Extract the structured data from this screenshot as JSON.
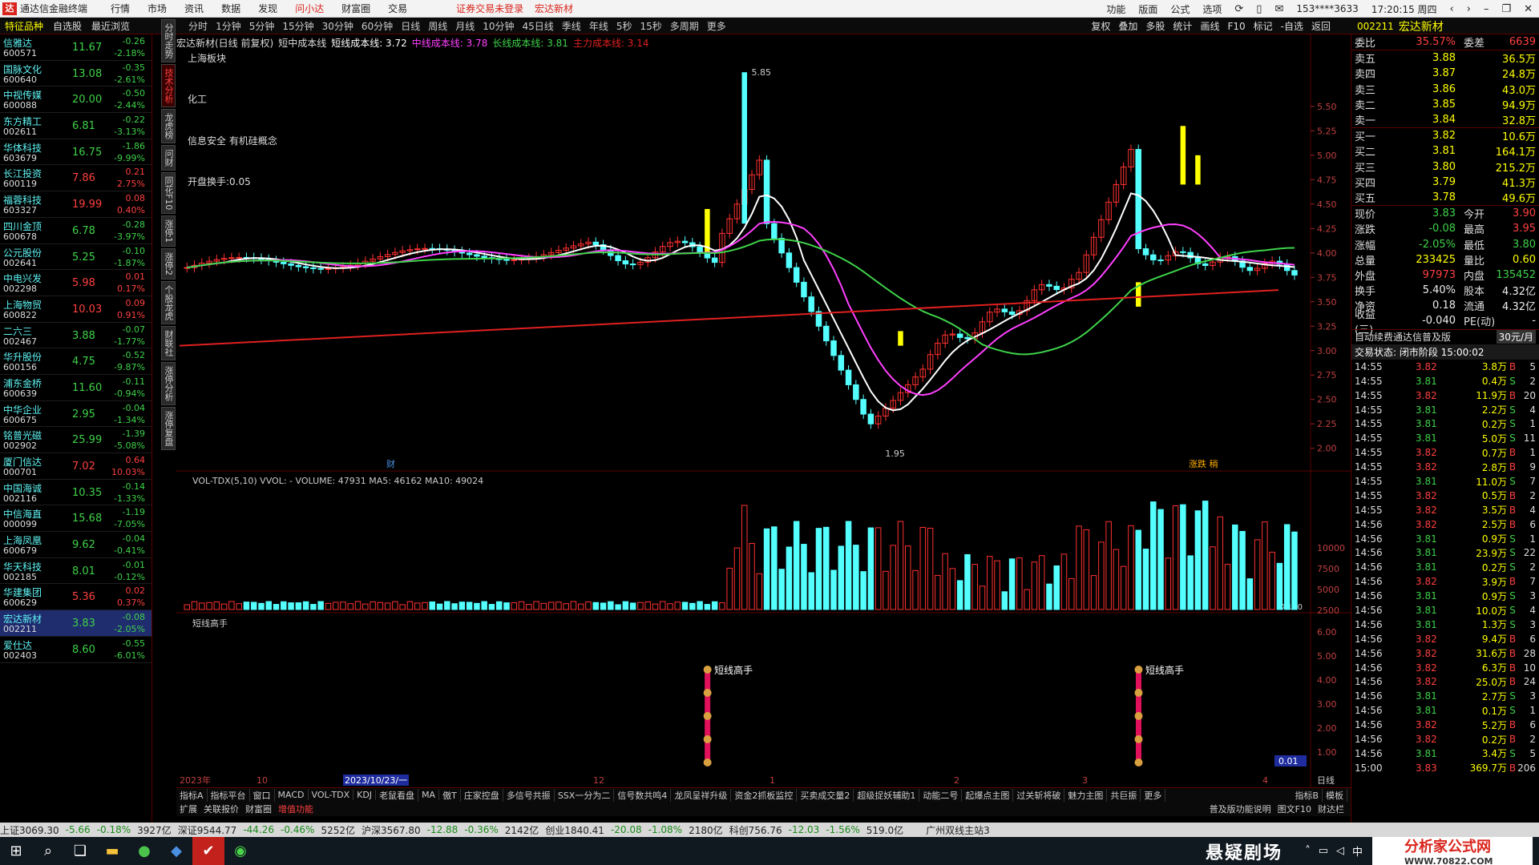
{
  "menubar": {
    "app_title": "通达信金融终端",
    "menus": [
      "行情",
      "市场",
      "资讯",
      "数据",
      "发现",
      "问小达",
      "财富圈",
      "交易"
    ],
    "notice": [
      "证券交易未登录",
      "宏达新材"
    ],
    "right_items": [
      "功能",
      "版面",
      "公式",
      "选项"
    ],
    "account": "153****3633",
    "clock": "17:20:15 周四"
  },
  "toolbar": {
    "tabs": [
      "分时",
      "1分钟",
      "5分钟",
      "15分钟",
      "30分钟",
      "60分钟",
      "日线",
      "周线",
      "月线",
      "10分钟",
      "45日线",
      "季线",
      "年线",
      "5秒",
      "15秒",
      "多周期",
      "更多"
    ],
    "right_tools": [
      "复权",
      "叠加",
      "多股",
      "统计",
      "画线",
      "F10",
      "标记",
      "-自选",
      "返回"
    ],
    "stock_code": "002211",
    "stock_name": "宏达新材"
  },
  "stocklist": {
    "headers": [
      "特征品种",
      "自选股",
      "最近浏览"
    ],
    "rows": [
      {
        "name": "信雅达",
        "code": "600571",
        "price": "11.67",
        "change": "-0.26",
        "pct": "-2.18%",
        "dir": "down"
      },
      {
        "name": "国脉文化",
        "code": "600640",
        "price": "13.08",
        "change": "-0.35",
        "pct": "-2.61%",
        "dir": "down"
      },
      {
        "name": "中视传媒",
        "code": "600088",
        "price": "20.00",
        "change": "-0.50",
        "pct": "-2.44%",
        "dir": "down"
      },
      {
        "name": "东方精工",
        "code": "002611",
        "price": "6.81",
        "change": "-0.22",
        "pct": "-3.13%",
        "dir": "down"
      },
      {
        "name": "华体科技",
        "code": "603679",
        "price": "16.75",
        "change": "-1.86",
        "pct": "-9.99%",
        "dir": "down"
      },
      {
        "name": "长江投资",
        "code": "600119",
        "price": "7.86",
        "change": "0.21",
        "pct": "2.75%",
        "dir": "up"
      },
      {
        "name": "福蓉科技",
        "code": "603327",
        "price": "19.99",
        "change": "0.08",
        "pct": "0.40%",
        "dir": "up"
      },
      {
        "name": "四川金顶",
        "code": "600678",
        "price": "6.78",
        "change": "-0.28",
        "pct": "-3.97%",
        "dir": "down"
      },
      {
        "name": "公元股份",
        "code": "002641",
        "price": "5.25",
        "change": "-0.10",
        "pct": "-1.87%",
        "dir": "down"
      },
      {
        "name": "中电兴发",
        "code": "002298",
        "price": "5.98",
        "change": "0.01",
        "pct": "0.17%",
        "dir": "up"
      },
      {
        "name": "上海物贸",
        "code": "600822",
        "price": "10.03",
        "change": "0.09",
        "pct": "0.91%",
        "dir": "up"
      },
      {
        "name": "二六三",
        "code": "002467",
        "price": "3.88",
        "change": "-0.07",
        "pct": "-1.77%",
        "dir": "down"
      },
      {
        "name": "华升股份",
        "code": "600156",
        "price": "4.75",
        "change": "-0.52",
        "pct": "-9.87%",
        "dir": "down"
      },
      {
        "name": "浦东金桥",
        "code": "600639",
        "price": "11.60",
        "change": "-0.11",
        "pct": "-0.94%",
        "dir": "down"
      },
      {
        "name": "中华企业",
        "code": "600675",
        "price": "2.95",
        "change": "-0.04",
        "pct": "-1.34%",
        "dir": "down"
      },
      {
        "name": "铭普光磁",
        "code": "002902",
        "price": "25.99",
        "change": "-1.39",
        "pct": "-5.08%",
        "dir": "down"
      },
      {
        "name": "厦门信达",
        "code": "000701",
        "price": "7.02",
        "change": "0.64",
        "pct": "10.03%",
        "dir": "up"
      },
      {
        "name": "中国海诚",
        "code": "002116",
        "price": "10.35",
        "change": "-0.14",
        "pct": "-1.33%",
        "dir": "down"
      },
      {
        "name": "中信海直",
        "code": "000099",
        "price": "15.68",
        "change": "-1.19",
        "pct": "-7.05%",
        "dir": "down"
      },
      {
        "name": "上海凤凰",
        "code": "600679",
        "price": "9.62",
        "change": "-0.04",
        "pct": "-0.41%",
        "dir": "down"
      },
      {
        "name": "华天科技",
        "code": "002185",
        "price": "8.01",
        "change": "-0.01",
        "pct": "-0.12%",
        "dir": "down"
      },
      {
        "name": "华建集团",
        "code": "600629",
        "price": "5.36",
        "change": "0.02",
        "pct": "0.37%",
        "dir": "up"
      },
      {
        "name": "宏达新材",
        "code": "002211",
        "price": "3.83",
        "change": "-0.08",
        "pct": "-2.05%",
        "dir": "down",
        "selected": true
      },
      {
        "name": "爱仕达",
        "code": "002403",
        "price": "8.60",
        "change": "-0.55",
        "pct": "-6.01%",
        "dir": "down"
      }
    ]
  },
  "sidetabs": [
    "分时走势",
    "技术分析",
    "龙虎榜",
    "问财",
    "同花F10",
    "涨停1",
    "涨停2",
    "个股龙虎",
    "财联社",
    "涨停分析",
    "涨停复盘"
  ],
  "chart_header": {
    "title": "宏达新材(日线 前复权)",
    "indicator": "短中成本线",
    "short_line": "短线成本线: 3.72",
    "mid_line": "中线成本线: 3.78",
    "long_line": "长线成本线: 3.81",
    "main_line": "主力成本线: 3.14"
  },
  "chart_notes": {
    "sector": "上海板块",
    "industry": "化工",
    "concepts": "信息安全 有机硅概念",
    "turnover": "开盘换手:0.05",
    "high_label": "5.85",
    "low_label": "1.95",
    "marker_cai": "财",
    "marker_right": "涨跌 稍"
  },
  "volume_header": "VOL-TDX(5,10) VVOL: - VOLUME: 47931  MA5: 46162  MA10: 49024",
  "signal_header": "短线高手",
  "signal_label": "短线高手",
  "axis": {
    "price_ticks": [
      "5.50",
      "5.25",
      "5.00",
      "4.75",
      "4.50",
      "4.25",
      "4.00",
      "3.75",
      "3.50",
      "3.25",
      "3.00",
      "2.75",
      "2.50",
      "2.25",
      "2.00"
    ],
    "vol_ticks": [
      "10000",
      "7500",
      "5000",
      "2500"
    ],
    "vol_unit": "X100",
    "signal_ticks": [
      "6.00",
      "5.00",
      "4.00",
      "3.00",
      "2.00",
      "1.00"
    ],
    "signal_current": "0.01",
    "period_label": "日线",
    "dates": [
      "2023年",
      "10",
      "2023/10/23/一",
      "12",
      "1",
      "2",
      "3",
      "4"
    ]
  },
  "chart_data": {
    "type": "line",
    "title": "宏达新材(日线 前复权)",
    "y_range": [
      1.95,
      5.85
    ],
    "series": [
      {
        "name": "短线成本线",
        "value": 3.72
      },
      {
        "name": "中线成本线",
        "value": 3.78
      },
      {
        "name": "长线成本线",
        "value": 3.81
      },
      {
        "name": "主力成本线",
        "value": 3.14
      }
    ]
  },
  "indicator_tabs": [
    "指标A",
    "指标平台",
    "窗口",
    "MACD",
    "VOL-TDX",
    "KDJ",
    "老鼠看盘",
    "MA",
    "傲T",
    "庄家控盘",
    "多信号共振",
    "SSX一分为二",
    "信号数共鸣4",
    "龙凤呈祥升级",
    "资金2抓板监控",
    "买卖成交量2",
    "超级捉妖辅助1",
    "动能二号",
    "起爆点主图",
    "过关斩将破",
    "魅力主图",
    "共巨振",
    "更多"
  ],
  "indicator_tabs_right": [
    "指标B",
    "模板"
  ],
  "sub_tabs": [
    "扩展",
    "关联报价",
    "财富圈",
    "增值功能"
  ],
  "sub_tabs_right": [
    "普及版功能说明",
    "图文F10",
    "财达栏"
  ],
  "rightpanel": {
    "webi": {
      "label": "委比",
      "value": "35.57%",
      "label2": "委差",
      "value2": "6639"
    },
    "asks": [
      {
        "label": "卖五",
        "price": "3.88",
        "vol": "36.5万"
      },
      {
        "label": "卖四",
        "price": "3.87",
        "vol": "24.8万"
      },
      {
        "label": "卖三",
        "price": "3.86",
        "vol": "43.0万"
      },
      {
        "label": "卖二",
        "price": "3.85",
        "vol": "94.9万"
      },
      {
        "label": "卖一",
        "price": "3.84",
        "vol": "32.8万"
      }
    ],
    "bids": [
      {
        "label": "买一",
        "price": "3.82",
        "vol": "10.6万"
      },
      {
        "label": "买二",
        "price": "3.81",
        "vol": "164.1万"
      },
      {
        "label": "买三",
        "price": "3.80",
        "vol": "215.2万"
      },
      {
        "label": "买四",
        "price": "3.79",
        "vol": "41.3万"
      },
      {
        "label": "买五",
        "price": "3.78",
        "vol": "49.6万"
      }
    ],
    "stats": [
      {
        "l1": "现价",
        "v1": "3.83",
        "l2": "今开",
        "v2": "3.90",
        "c1": "down",
        "c2": "up"
      },
      {
        "l1": "涨跌",
        "v1": "-0.08",
        "l2": "最高",
        "v2": "3.95",
        "c1": "down",
        "c2": "up"
      },
      {
        "l1": "涨幅",
        "v1": "-2.05%",
        "l2": "最低",
        "v2": "3.80",
        "c1": "down",
        "c2": "down"
      },
      {
        "l1": "总量",
        "v1": "233425",
        "l2": "量比",
        "v2": "0.60",
        "c1": "yellow",
        "c2": "yellow"
      },
      {
        "l1": "外盘",
        "v1": "97973",
        "l2": "内盘",
        "v2": "135452",
        "c1": "up",
        "c2": "down"
      },
      {
        "l1": "换手",
        "v1": "5.40%",
        "l2": "股本",
        "v2": "4.32亿",
        "c1": "white",
        "c2": "white"
      },
      {
        "l1": "净资",
        "v1": "0.18",
        "l2": "流通",
        "v2": "4.32亿",
        "c1": "white",
        "c2": "white"
      },
      {
        "l1": "收益(三)",
        "v1": "-0.040",
        "l2": "PE(动)",
        "v2": "-",
        "c1": "white",
        "c2": "white"
      }
    ],
    "promo": "自动续费通达信普及版",
    "promo_price": "30元/月",
    "trade_status": "交易状态: 闭市阶段 15:00:02",
    "ticks": [
      {
        "t": "14:55",
        "p": "3.82",
        "v": "3.8万",
        "bs": "B",
        "n": "5"
      },
      {
        "t": "14:55",
        "p": "3.81",
        "v": "0.4万",
        "bs": "S",
        "n": "2"
      },
      {
        "t": "14:55",
        "p": "3.82",
        "v": "11.9万",
        "bs": "B",
        "n": "20"
      },
      {
        "t": "14:55",
        "p": "3.81",
        "v": "2.2万",
        "bs": "S",
        "n": "4"
      },
      {
        "t": "14:55",
        "p": "3.81",
        "v": "0.2万",
        "bs": "S",
        "n": "1"
      },
      {
        "t": "14:55",
        "p": "3.81",
        "v": "5.0万",
        "bs": "S",
        "n": "11"
      },
      {
        "t": "14:55",
        "p": "3.82",
        "v": "0.7万",
        "bs": "B",
        "n": "1"
      },
      {
        "t": "14:55",
        "p": "3.82",
        "v": "2.8万",
        "bs": "B",
        "n": "9"
      },
      {
        "t": "14:55",
        "p": "3.81",
        "v": "11.0万",
        "bs": "S",
        "n": "7"
      },
      {
        "t": "14:55",
        "p": "3.82",
        "v": "0.5万",
        "bs": "B",
        "n": "2"
      },
      {
        "t": "14:55",
        "p": "3.82",
        "v": "3.5万",
        "bs": "B",
        "n": "4"
      },
      {
        "t": "14:56",
        "p": "3.82",
        "v": "2.5万",
        "bs": "B",
        "n": "6"
      },
      {
        "t": "14:56",
        "p": "3.81",
        "v": "0.9万",
        "bs": "S",
        "n": "1"
      },
      {
        "t": "14:56",
        "p": "3.81",
        "v": "23.9万",
        "bs": "S",
        "n": "22"
      },
      {
        "t": "14:56",
        "p": "3.81",
        "v": "0.2万",
        "bs": "S",
        "n": "2"
      },
      {
        "t": "14:56",
        "p": "3.82",
        "v": "3.9万",
        "bs": "B",
        "n": "7"
      },
      {
        "t": "14:56",
        "p": "3.81",
        "v": "0.9万",
        "bs": "S",
        "n": "3"
      },
      {
        "t": "14:56",
        "p": "3.81",
        "v": "10.0万",
        "bs": "S",
        "n": "4"
      },
      {
        "t": "14:56",
        "p": "3.81",
        "v": "1.3万",
        "bs": "S",
        "n": "3"
      },
      {
        "t": "14:56",
        "p": "3.82",
        "v": "9.4万",
        "bs": "B",
        "n": "6"
      },
      {
        "t": "14:56",
        "p": "3.82",
        "v": "31.6万",
        "bs": "B",
        "n": "28"
      },
      {
        "t": "14:56",
        "p": "3.82",
        "v": "6.3万",
        "bs": "B",
        "n": "10"
      },
      {
        "t": "14:56",
        "p": "3.82",
        "v": "25.0万",
        "bs": "B",
        "n": "24"
      },
      {
        "t": "14:56",
        "p": "3.81",
        "v": "2.7万",
        "bs": "S",
        "n": "3"
      },
      {
        "t": "14:56",
        "p": "3.81",
        "v": "0.1万",
        "bs": "S",
        "n": "1"
      },
      {
        "t": "14:56",
        "p": "3.82",
        "v": "5.2万",
        "bs": "B",
        "n": "6"
      },
      {
        "t": "14:56",
        "p": "3.82",
        "v": "0.2万",
        "bs": "B",
        "n": "2"
      },
      {
        "t": "14:56",
        "p": "3.81",
        "v": "3.4万",
        "bs": "S",
        "n": "5"
      },
      {
        "t": "15:00",
        "p": "3.83",
        "v": "369.7万",
        "bs": "B",
        "n": "206"
      }
    ]
  },
  "statusbar": {
    "items": [
      "上证3069.30",
      "-5.66",
      "-0.18%",
      "3927亿",
      "深证9544.77",
      "-44.26",
      "-0.46%",
      "5252亿",
      "沪深3567.80",
      "-12.88",
      "-0.36%",
      "2142亿",
      "创业1840.41",
      "-20.08",
      "-1.08%",
      "2180亿",
      "科创756.76",
      "-12.03",
      "-1.56%",
      "519.0亿"
    ],
    "server": "广州双线主站3"
  },
  "taskbar": {
    "banner": "悬疑剧场",
    "brand": "分析家公式网",
    "brand_url": "WWW.70822.COM",
    "tray_lang": "中"
  },
  "colors": {
    "up": "#ff4040",
    "down": "#3fd24a",
    "kline_up": "#ff3030",
    "kline_down": "#54ffff",
    "ma_short": "#ffffff",
    "ma_mid": "#ff40ff",
    "ma_long": "#3fd24a",
    "ma_main": "#e02020"
  }
}
